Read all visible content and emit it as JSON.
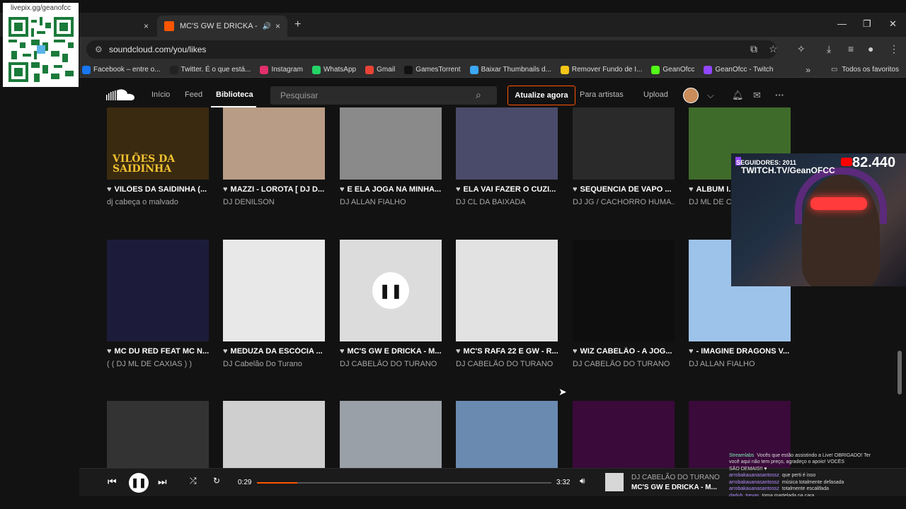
{
  "qr": {
    "label": "livepix.gg/geanofcc"
  },
  "browser": {
    "tab_inactive_close": "×",
    "tab_active_title": "MC'S GW E DRICKA - MOVI",
    "tab_active_audio": "🔊",
    "tab_active_close": "×",
    "new_tab": "+",
    "url": "soundcloud.com/you/likes",
    "bookmarks": [
      {
        "label": "Facebook – entre o...",
        "color": "#1877f2"
      },
      {
        "label": "Twitter. É o que está...",
        "color": "#222222"
      },
      {
        "label": "Instagram",
        "color": "#e1306c"
      },
      {
        "label": "WhatsApp",
        "color": "#25d366"
      },
      {
        "label": "Gmail",
        "color": "#ea4335"
      },
      {
        "label": "GamesTorrent",
        "color": "#111111"
      },
      {
        "label": "Baixar Thumbnails d...",
        "color": "#3ba7f5"
      },
      {
        "label": "Remover Fundo de I...",
        "color": "#f5c518"
      },
      {
        "label": "GeanOfcc",
        "color": "#53fc18"
      },
      {
        "label": "GeanOfcc - Twitch",
        "color": "#9146ff"
      }
    ],
    "bookmarks_more": "»",
    "all_bookmarks": "Todos os favoritos"
  },
  "sc": {
    "nav": [
      "Início",
      "Feed",
      "Biblioteca"
    ],
    "search_placeholder": "Pesquisar",
    "upgrade": "Atualize agora",
    "for_artists": "Para artistas",
    "upload": "Upload"
  },
  "tracks": [
    {
      "title": "VILÕES DA SAIDINHA (...",
      "artist": "dj cabeça o malvado",
      "cover": "#3a2a10",
      "caption": "VILÕES DA SAIDINHA"
    },
    {
      "title": "MAZZI - LOROTA [ DJ D...",
      "artist": "DJ DENILSON",
      "cover": "#b89c85",
      "caption": ""
    },
    {
      "title": "E ELA JOGA NA MINHA...",
      "artist": "DJ ALLAN FIALHO",
      "cover": "#8a8a8a",
      "caption": ""
    },
    {
      "title": "ELA VAI FAZER O CUZI...",
      "artist": "DJ CL DA BAIXADA",
      "cover": "#4a4a6a",
      "caption": ""
    },
    {
      "title": "SEQUENCIA DE VAPO ...",
      "artist": "DJ JG / CACHORRO HUMA...",
      "cover": "#2a2a2a",
      "caption": ""
    },
    {
      "title": "ALBUM I...",
      "artist": "DJ ML DE CA...",
      "cover": "#3f6b2a",
      "caption": ""
    },
    {
      "title": "MC DU RED FEAT MC N...",
      "artist": "( ( DJ ML DE CAXIAS ) )",
      "cover": "#1c1c3a",
      "caption": ""
    },
    {
      "title": "MEDUZA DA ESCÓCIA ...",
      "artist": "DJ Cabelão Do Turano",
      "cover": "#e8e8e8",
      "caption": ""
    },
    {
      "title": "MC'S GW E DRICKA - M...",
      "artist": "DJ CABELÃO DO TURANO",
      "cover": "#dcdcdc",
      "caption": "",
      "playing": true
    },
    {
      "title": "MC'S RAFA 22 E GW - R...",
      "artist": "DJ CABELÃO DO TURANO",
      "cover": "#e2e2e2",
      "caption": ""
    },
    {
      "title": "WIZ CABELÃO - A JOG...",
      "artist": "DJ CABELÃO DO TURANO",
      "cover": "#0e0e0e",
      "caption": ""
    },
    {
      "title": "- IMAGINE DRAGONS V...",
      "artist": "DJ ALLAN FIALHO",
      "cover": "#9ec3ea",
      "caption": ""
    },
    {
      "title": "",
      "artist": "",
      "cover": "#333333",
      "caption": ""
    },
    {
      "title": "",
      "artist": "",
      "cover": "#cfcfcf",
      "caption": ""
    },
    {
      "title": "",
      "artist": "",
      "cover": "#9aa0a8",
      "caption": ""
    },
    {
      "title": "",
      "artist": "",
      "cover": "#6a8ab0",
      "caption": ""
    },
    {
      "title": "",
      "artist": "",
      "cover": "#3a0a3a",
      "caption": ""
    },
    {
      "title": "",
      "artist": "",
      "cover": "#3a0a3a",
      "caption": ""
    }
  ],
  "stream": {
    "followers": "SEGUIDORES: 2011",
    "twitch": "TWITCH.TV/GeanOFCC",
    "count": "82.440"
  },
  "chat": [
    {
      "user": "Streamlabs",
      "text": "Vocês que estão assistindo a Live! OBRIGADO! Ter"
    },
    {
      "user": "",
      "text": "você aqui não tem preço, agradeço o apoio! VOCÊS"
    },
    {
      "user": "",
      "text": "SÃO DEMAIS!! ♥"
    },
    {
      "user": "arrobakauanasantossz",
      "text": "que perti é isso"
    },
    {
      "user": "arrobakauanasantossz",
      "text": "música totalmente defasada"
    },
    {
      "user": "arrobakauanasantossz",
      "text": "totalmente escalifada"
    },
    {
      "user": "daduh_trevas",
      "text": "toma martelada na cara"
    }
  ],
  "player": {
    "current": "0:29",
    "total": "3:32",
    "progress": 0.137,
    "artist": "DJ CABELÃO DO TURANO",
    "title": "MC'S GW E DRICKA - M..."
  }
}
